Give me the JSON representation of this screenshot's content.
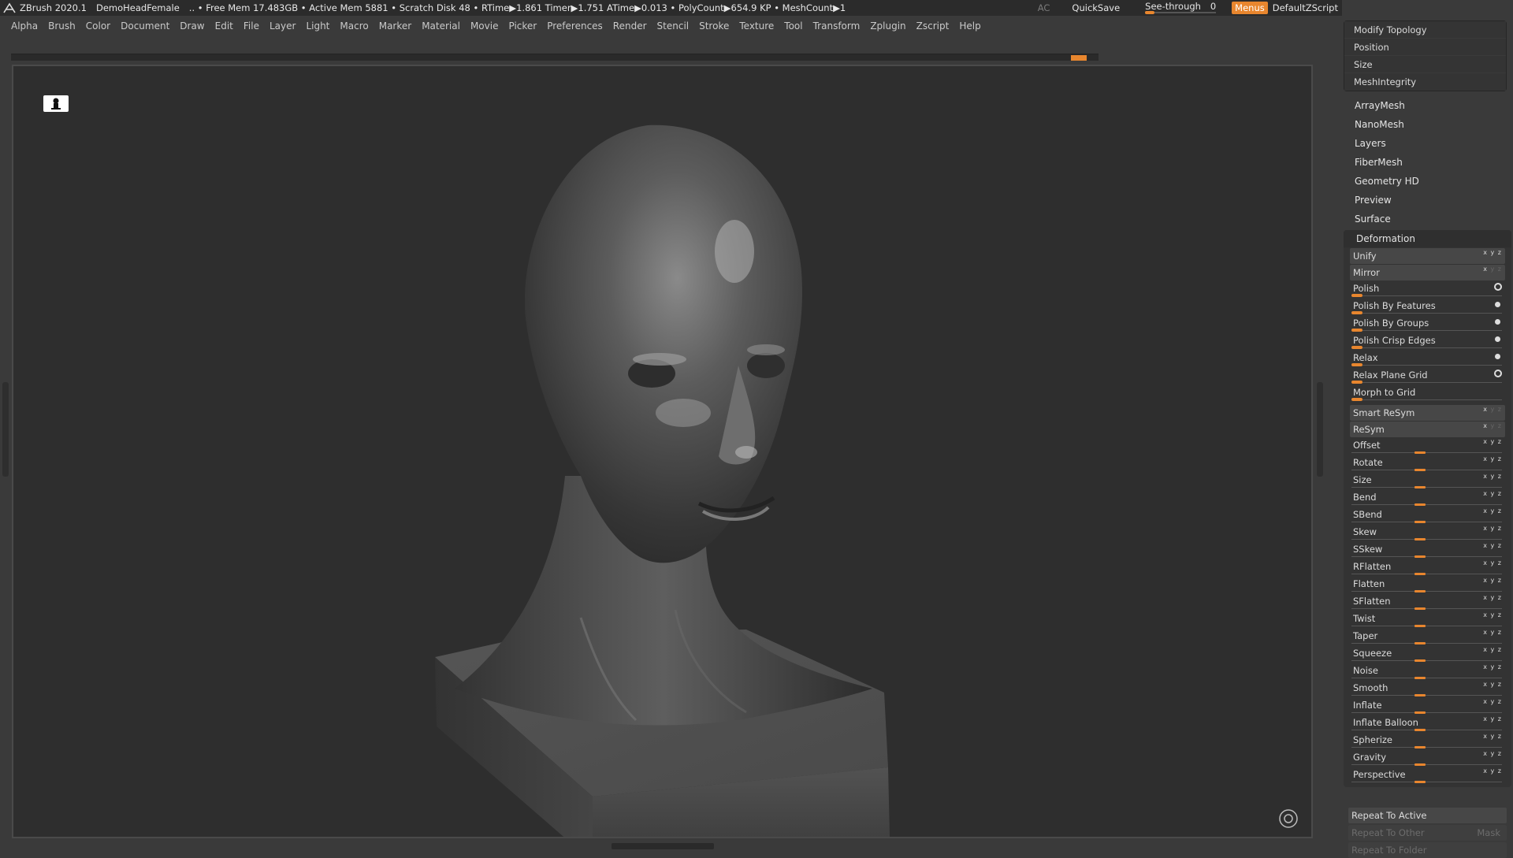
{
  "app": {
    "title": "ZBrush 2020.1",
    "document": "DemoHeadFemale",
    "stats": ".. • Free Mem 17.483GB • Active Mem 5881 • Scratch Disk 48 •  RTime▶1.861 Timer▶1.751 ATime▶0.013 • PolyCount▶654.9 KP  • MeshCount▶1",
    "ac": "AC",
    "quicksave": "QuickSave",
    "see_through_label": "See-through",
    "see_through_value": "0",
    "menus_label": "Menus",
    "script_label": "DefaultZScript"
  },
  "menubar": [
    "Alpha",
    "Brush",
    "Color",
    "Document",
    "Draw",
    "Edit",
    "File",
    "Layer",
    "Light",
    "Macro",
    "Marker",
    "Material",
    "Movie",
    "Picker",
    "Preferences",
    "Render",
    "Stencil",
    "Stroke",
    "Texture",
    "Tool",
    "Transform",
    "Zplugin",
    "Zscript",
    "Help"
  ],
  "panel": {
    "top_group": [
      "Modify Topology",
      "Position",
      "Size",
      "MeshIntegrity"
    ],
    "subpalettes": [
      "ArrayMesh",
      "NanoMesh",
      "Layers",
      "FiberMesh",
      "Geometry HD",
      "Preview",
      "Surface"
    ],
    "deformation_title": "Deformation",
    "buttons": [
      "Unify",
      "Mirror"
    ],
    "polish_items": [
      {
        "label": "Polish",
        "indicator": "ring"
      },
      {
        "label": "Polish By Features",
        "indicator": "dot"
      },
      {
        "label": "Polish By Groups",
        "indicator": "dot"
      },
      {
        "label": "Polish Crisp Edges",
        "indicator": "dot"
      },
      {
        "label": "Relax",
        "indicator": "dot"
      },
      {
        "label": "Relax Plane Grid",
        "indicator": "ring"
      },
      {
        "label": "Morph to Grid",
        "indicator": "none"
      }
    ],
    "buttons2": [
      "Smart ReSym",
      "ReSym"
    ],
    "sliders": [
      "Offset",
      "Rotate",
      "Size",
      "Bend",
      "SBend",
      "Skew",
      "SSkew",
      "RFlatten",
      "Flatten",
      "SFlatten",
      "Twist",
      "Taper",
      "Squeeze",
      "Noise",
      "Smooth",
      "Inflate",
      "Inflate Balloon",
      "Spherize",
      "Gravity",
      "Perspective"
    ],
    "repeat_active": "Repeat To Active",
    "repeat_other": "Repeat To Other",
    "mask": "Mask",
    "repeat_folder": "Repeat To Folder"
  },
  "colors": {
    "accent": "#e8862e",
    "background": "#3a3a3a",
    "viewport": "#2e2e2e"
  }
}
